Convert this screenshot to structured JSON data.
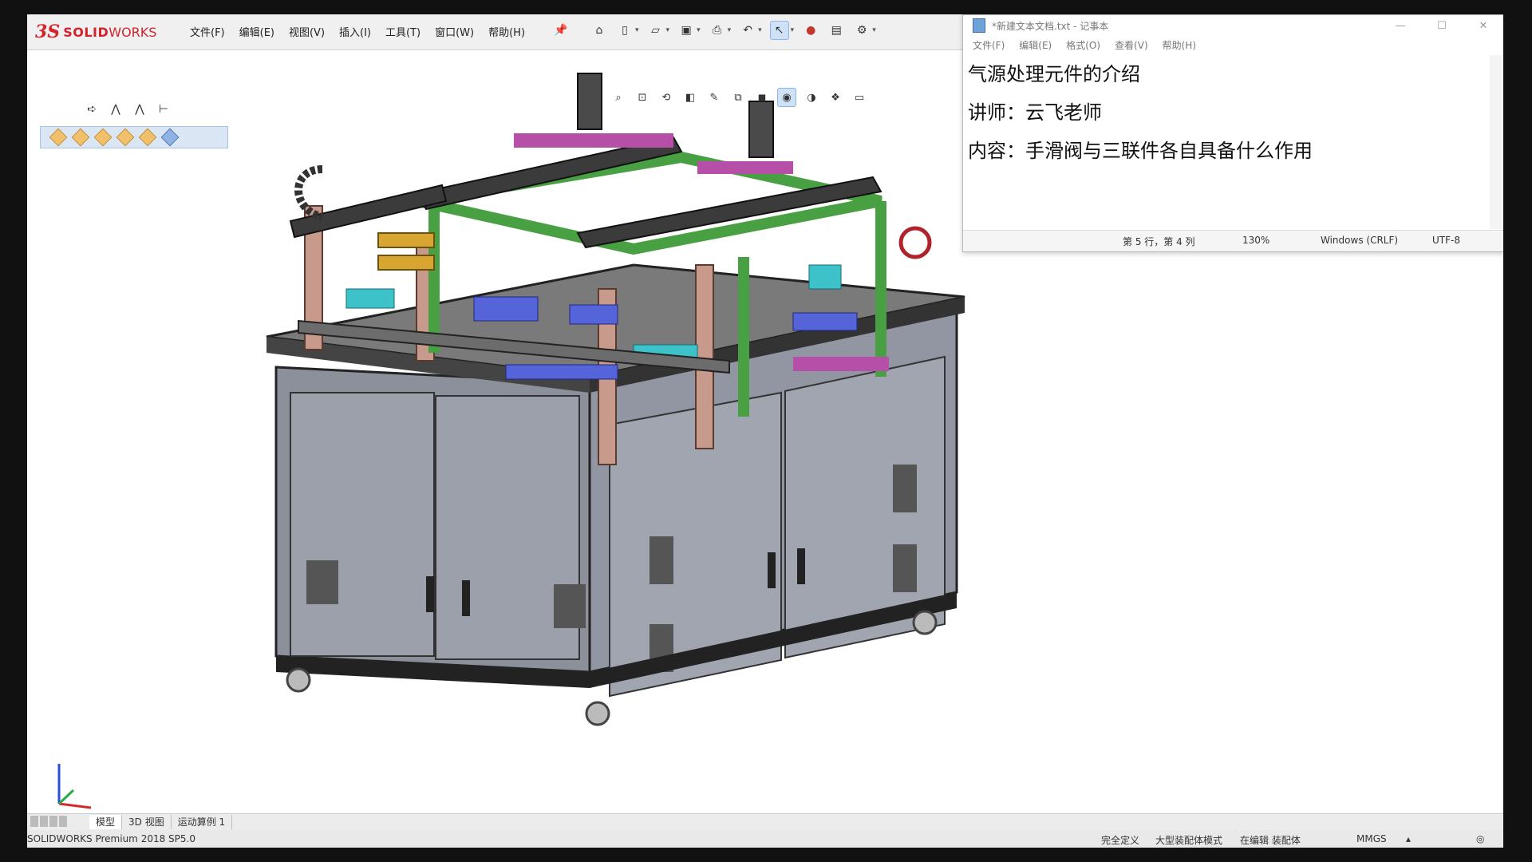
{
  "solidworks": {
    "logo": {
      "ds": "3S",
      "solid": "SOLID",
      "works": "WORKS"
    },
    "menu": [
      "文件(F)",
      "编辑(E)",
      "视图(V)",
      "插入(I)",
      "工具(T)",
      "窗口(W)",
      "帮助(H)"
    ],
    "tabs": [
      "模型",
      "3D 视图",
      "运动算例 1"
    ],
    "status": {
      "version": "SOLIDWORKS Premium 2018 SP5.0",
      "defined": "完全定义",
      "mode": "大型装配体模式",
      "editing": "在编辑 装配体",
      "units": "MMGS"
    }
  },
  "notepad": {
    "title": "*新建文本文档.txt - 记事本",
    "menu": [
      "文件(F)",
      "编辑(E)",
      "格式(O)",
      "查看(V)",
      "帮助(H)"
    ],
    "lines": [
      "气源处理元件的介绍",
      "讲师：云飞老师",
      "内容：手滑阀与三联件各自具备什么作用"
    ],
    "status": {
      "position": "第 5 行，第 4 列",
      "zoom": "130%",
      "line_ending": "Windows (CRLF)",
      "encoding": "UTF-8"
    },
    "window_controls": {
      "minimize": "—",
      "maximize": "☐",
      "close": "✕"
    }
  },
  "colors": {
    "sw_red": "#d3242b",
    "frame_green": "#49a043",
    "cabinet": "#8f939f",
    "post_pink": "#c89a8c"
  }
}
